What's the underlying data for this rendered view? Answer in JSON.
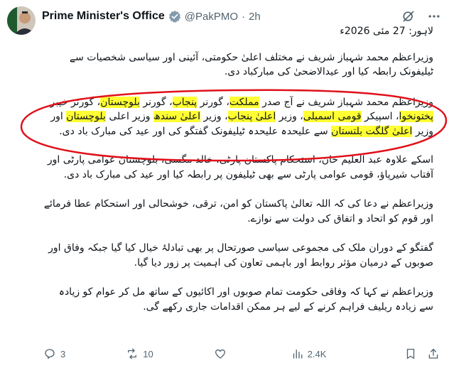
{
  "post": {
    "author_name": "Prime Minister's Office",
    "handle": "@PakPMO",
    "separator": "·",
    "time": "2h",
    "dateline": "لاہور: 27 مئی 2026ء",
    "p1": "وزیراعظم محمد شہباز شریف نے مختلف اعلیٰ حکومتی، آئینی اور سیاسی شخصیات سے ٹیلیفونک رابطہ کیا اور عیدالاضحیٰ کی مبارکباد دی.",
    "p2_segments": [
      {
        "t": "وزیراعظم محمد شہباز شریف نے آج صدر ",
        "h": false
      },
      {
        "t": "مملکت",
        "h": true
      },
      {
        "t": "، گورنر ",
        "h": false
      },
      {
        "t": "پنجاب",
        "h": true
      },
      {
        "t": "، گورنر ",
        "h": false
      },
      {
        "t": "بلوچستان",
        "h": true
      },
      {
        "t": "، گورنر خیبر ",
        "h": false
      },
      {
        "t": "پختونخوا",
        "h": true
      },
      {
        "t": "، اسپیکر ",
        "h": false
      },
      {
        "t": "قومی اسمبلی",
        "h": true
      },
      {
        "t": "، وزیر ",
        "h": false
      },
      {
        "t": "اعلیٰ پنجاب",
        "h": true
      },
      {
        "t": "، وزیر ",
        "h": false
      },
      {
        "t": "اعلیٰ سندھ",
        "h": true
      },
      {
        "t": " وزیر اعلی ",
        "h": false
      },
      {
        "t": "بلوچستان",
        "h": true
      },
      {
        "t": " اور وزیر ",
        "h": false
      },
      {
        "t": "اعلیٰ گلگت بلتستان",
        "h": true
      },
      {
        "t": " سے علیحدہ علیحدہ ٹیلیفونک گفتگو کی اور عید کی مبارک باد دی.",
        "h": false
      }
    ],
    "p3": "اسکے علاوہ عبد العلیم خان، استحکام پاکستان پارٹی، خالد مگسی، بلوچستان عوامی پارٹی اور آفتاب شیرپاؤ، قومی عوامی پارٹی سے بھی ٹیلیفون پر رابطہ کیا اور عید کی مبارک باد دی.",
    "p4": "وزیراعظم نے دعا کی کہ اللہ تعالیٰ پاکستان کو امن، ترقی، خوشحالی اور استحکام عطا فرمائے اور قوم کو اتحاد و اتفاق کی دولت سے نوازے.",
    "p5": "گفتگو کے دوران ملک کی مجموعی سیاسی صورتحال پر بھی تبادلۂ خیال کیا گیا جبکہ وفاق اور صوبوں کے درمیان مؤثر روابط اور باہمی تعاون کی اہمیت پر زور دیا گیا.",
    "p6": "وزیراعظم نے کہا کہ وفاقی حکومت تمام صوبوں اور اکائیوں کے ساتھ مل کر عوام کو زیادہ سے زیادہ ریلیف فراہم کرنے کے لیے ہر ممکن اقدامات جاری رکھے گی."
  },
  "actions": {
    "replies": "3",
    "reposts": "10",
    "views": "2.4K"
  },
  "colors": {
    "highlight": "#ffff33",
    "annotation_ellipse": "#e0101a",
    "verified": "#829aab",
    "muted": "#536471"
  },
  "icons": [
    "grok-icon",
    "more-icon",
    "reply-icon",
    "repost-icon",
    "like-icon",
    "views-icon",
    "bookmark-icon",
    "share-icon"
  ]
}
